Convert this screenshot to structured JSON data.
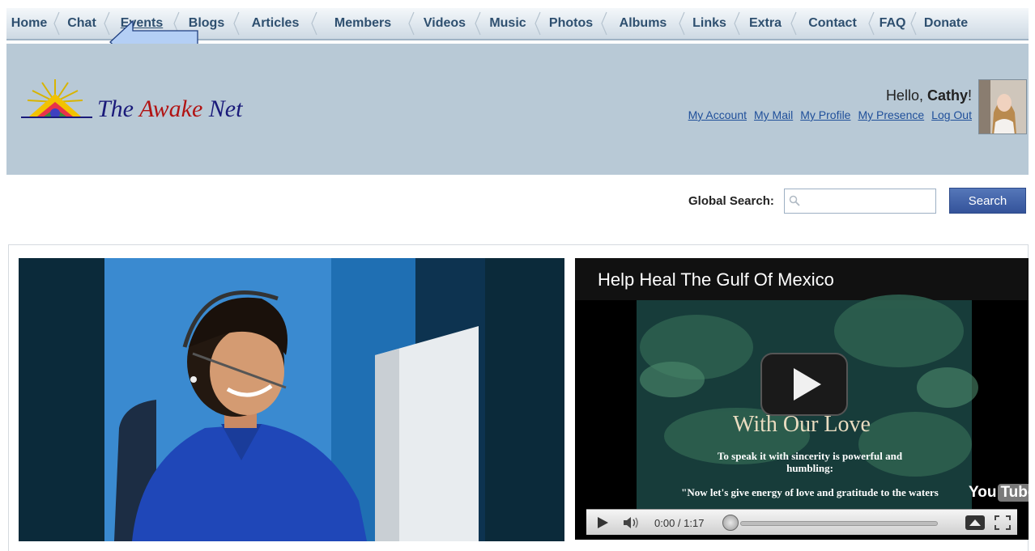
{
  "nav": {
    "items": [
      {
        "label": "Home"
      },
      {
        "label": "Chat"
      },
      {
        "label": "Events"
      },
      {
        "label": "Blogs"
      },
      {
        "label": "Articles"
      },
      {
        "label": "Members"
      },
      {
        "label": "Videos"
      },
      {
        "label": "Music"
      },
      {
        "label": "Photos"
      },
      {
        "label": "Albums"
      },
      {
        "label": "Links"
      },
      {
        "label": "Extra"
      },
      {
        "label": "Contact"
      },
      {
        "label": "FAQ"
      },
      {
        "label": "Donate"
      }
    ]
  },
  "header": {
    "site_title_part1": "The ",
    "site_title_part2": "Awake",
    "site_title_part3": " Net",
    "greeting_prefix": "Hello, ",
    "user_name": "Cathy",
    "greeting_suffix": "!",
    "user_links": [
      {
        "label": "My Account"
      },
      {
        "label": "My Mail"
      },
      {
        "label": "My Profile"
      },
      {
        "label": "My Presence"
      },
      {
        "label": "Log Out"
      }
    ]
  },
  "search": {
    "label": "Global Search:",
    "value": "",
    "button_label": "Search"
  },
  "video": {
    "title": "Help Heal The Gulf Of Mexico",
    "overlay_heading": "With Our Love",
    "overlay_line1": "To speak it with sincerity is powerful and humbling:",
    "overlay_line2": "\"Now let's give energy of love and gratitude to the waters",
    "time_display": "0:00 / 1:17",
    "progress": 0,
    "brand_you": "You",
    "brand_tube": "Tube"
  },
  "colors": {
    "header_band": "#b8c9d6",
    "nav_text": "#2e4f6f",
    "link": "#1f4f9a",
    "search_button": "#34539a"
  }
}
